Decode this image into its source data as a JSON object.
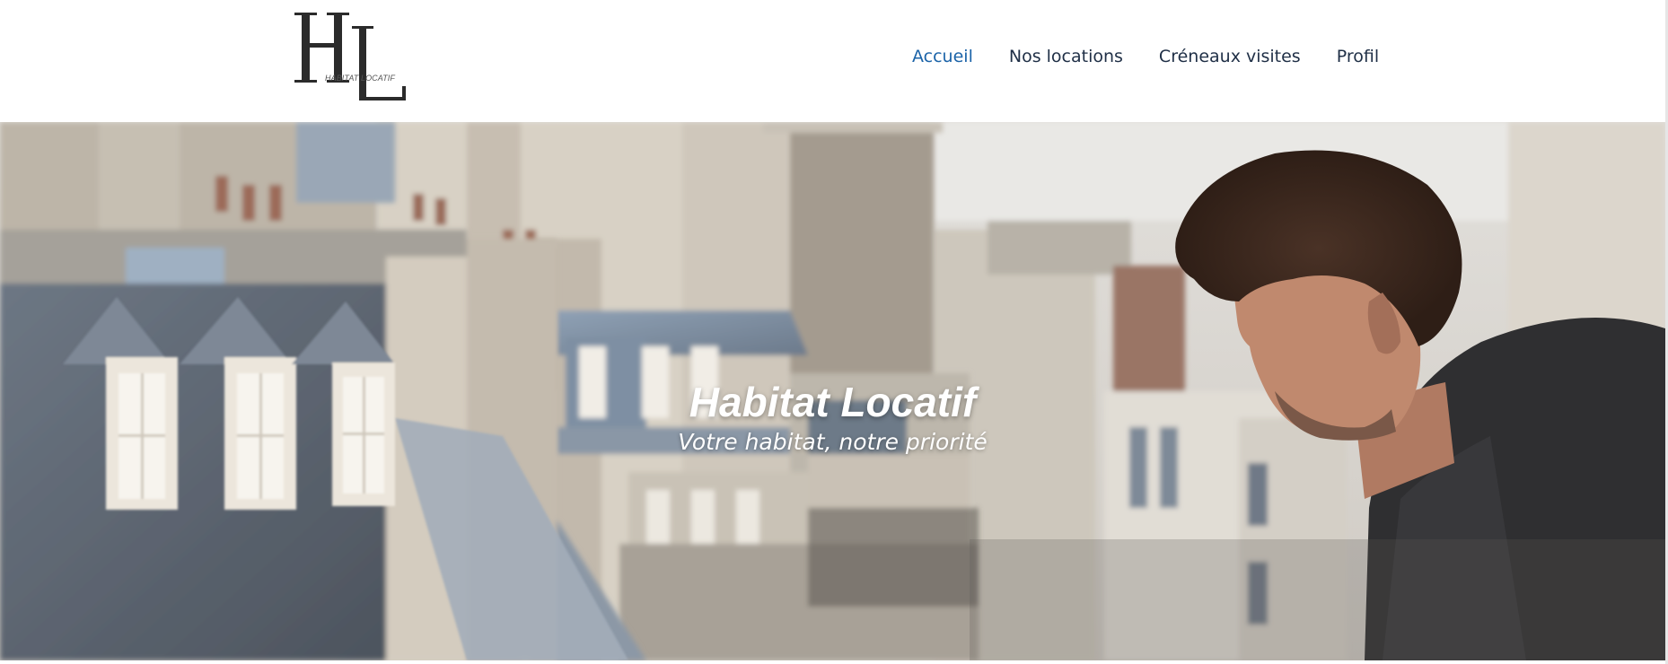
{
  "brand": {
    "logo_letters": "HL",
    "tagline": "HABITAT LOCATIF"
  },
  "nav": {
    "items": [
      {
        "label": "Accueil",
        "active": true
      },
      {
        "label": "Nos locations",
        "active": false
      },
      {
        "label": "Créneaux visites",
        "active": false
      },
      {
        "label": "Profil",
        "active": false
      }
    ]
  },
  "hero": {
    "title": "Habitat Locatif",
    "subtitle": "Votre habitat, notre priorité",
    "image": "rooftops-of-paris-man-on-balcony"
  },
  "colors": {
    "nav_text": "#1f2f46",
    "nav_active": "#1b63a8",
    "logo": "#2b2b2b"
  }
}
